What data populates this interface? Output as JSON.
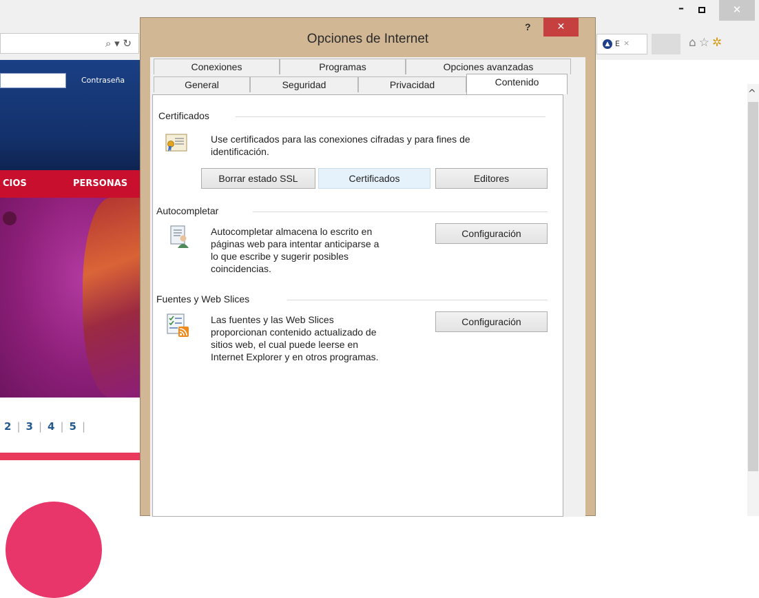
{
  "browser": {
    "address_icons": "⌕ ▾ ↻",
    "tab_label": "E",
    "tab_close": "×",
    "login_password_label": "Contraseña",
    "nav_items": [
      "CIOS",
      "PERSONAS"
    ],
    "pager": [
      "2",
      "3",
      "4",
      "5"
    ]
  },
  "dialog": {
    "title": "Opciones de Internet",
    "help_label": "?",
    "close_label": "✕",
    "tabs_row1": [
      "Conexiones",
      "Programas",
      "Opciones avanzadas"
    ],
    "tabs_row2": [
      "General",
      "Seguridad",
      "Privacidad",
      "Contenido"
    ],
    "active_tab": "Contenido",
    "certificates": {
      "heading": "Certificados",
      "line1": "Use certificados para las conexiones cifradas y para fines de",
      "line2": "identificación.",
      "btn_clear_ssl": "Borrar estado SSL",
      "btn_certificates": "Certificados",
      "btn_publishers": "Editores"
    },
    "autocomplete": {
      "heading": "Autocompletar",
      "line1": "Autocompletar almacena lo escrito en",
      "line2": "páginas web para intentar anticiparse a",
      "line3": "lo que escribe y sugerir posibles",
      "line4": "coincidencias.",
      "btn_settings": "Configuración"
    },
    "feeds": {
      "heading": "Fuentes y Web Slices",
      "line1": "Las fuentes y las Web Slices",
      "line2": "proporcionan contenido actualizado de",
      "line3": "sitios web, el cual puede leerse en",
      "line4": "Internet Explorer y en otros programas.",
      "btn_settings": "Configuración"
    }
  },
  "icons": {
    "certificate": "certificate-icon",
    "autocomplete": "autocomplete-icon",
    "feeds": "feeds-icon"
  },
  "colors": {
    "dialog_frame": "#d2b794",
    "close_red": "#c74040",
    "site_nav_red": "#c8102e"
  }
}
